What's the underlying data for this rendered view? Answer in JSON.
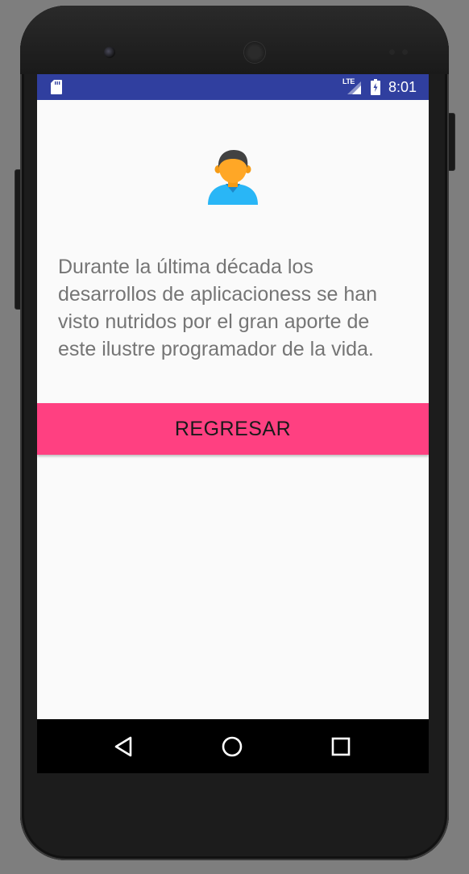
{
  "status_bar": {
    "network_label": "LTE",
    "time": "8:01",
    "icons": [
      "sd-card-icon",
      "signal-icon",
      "battery-icon"
    ]
  },
  "content": {
    "avatar_icon": "person-avatar-icon",
    "description": "Durante la última década los desarrollos de aplicacioness se han visto nutridos por el gran aporte de este ilustre programador de la vida.",
    "button_label": "REGRESAR"
  },
  "navigation_bar": {
    "icons": [
      "back-icon",
      "home-icon",
      "recents-icon"
    ]
  },
  "colors": {
    "status_bar": "#303f9f",
    "accent_button": "#ff4081",
    "background": "#fafafa",
    "body_text": "#757575",
    "avatar_shirt": "#29b6f6",
    "avatar_skin": "#ffa726"
  }
}
